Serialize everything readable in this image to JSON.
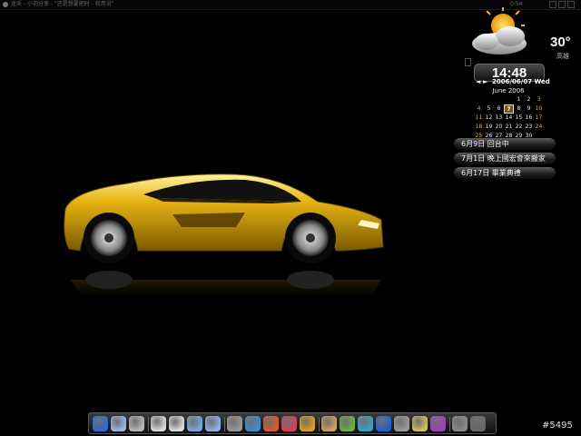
{
  "titlebar": {
    "title": "迷采 - 小羽分享 - \"还是想要把时 - 就用说\"",
    "clock": "0:54"
  },
  "weather": {
    "temperature": "30°",
    "location": "高雄",
    "icon": "sun-cloud-icon"
  },
  "clock_widget": {
    "time": "14:48",
    "date": "2006/06/07 Wed",
    "arrows": "◄ ►"
  },
  "calendar": {
    "title": "June 2006",
    "weeks": [
      [
        "",
        "",
        "",
        "",
        "1",
        "2",
        "3"
      ],
      [
        "4",
        "5",
        "6",
        "7",
        "8",
        "9",
        "10"
      ],
      [
        "11",
        "12",
        "13",
        "14",
        "15",
        "16",
        "17"
      ],
      [
        "18",
        "19",
        "20",
        "21",
        "22",
        "23",
        "24"
      ],
      [
        "25",
        "26",
        "27",
        "28",
        "29",
        "30",
        ""
      ]
    ],
    "today": "7"
  },
  "events": [
    {
      "label": "6月9日 回台中"
    },
    {
      "label": "7月1日 晚上國宏會來搬家"
    },
    {
      "label": "6月17日 畢業典禮"
    }
  ],
  "dock": {
    "icons": [
      "ie-icon",
      "finder-icon",
      "mac-icon",
      "drive-icon",
      "drive2-icon",
      "mail-icon",
      "photos-icon",
      "pen-icon",
      "pencil-icon",
      "brush-icon",
      "media-icon",
      "player-icon",
      "messenger-icon",
      "firefox-icon",
      "network-icon",
      "bluetooth-icon",
      "tools-icon",
      "settings-icon",
      "chat-icon",
      "trash-icon",
      "power-icon"
    ]
  },
  "watermark": "#5495",
  "colors": {
    "background": "#000000",
    "car": "#e8b514",
    "accent": "#d8b540"
  }
}
